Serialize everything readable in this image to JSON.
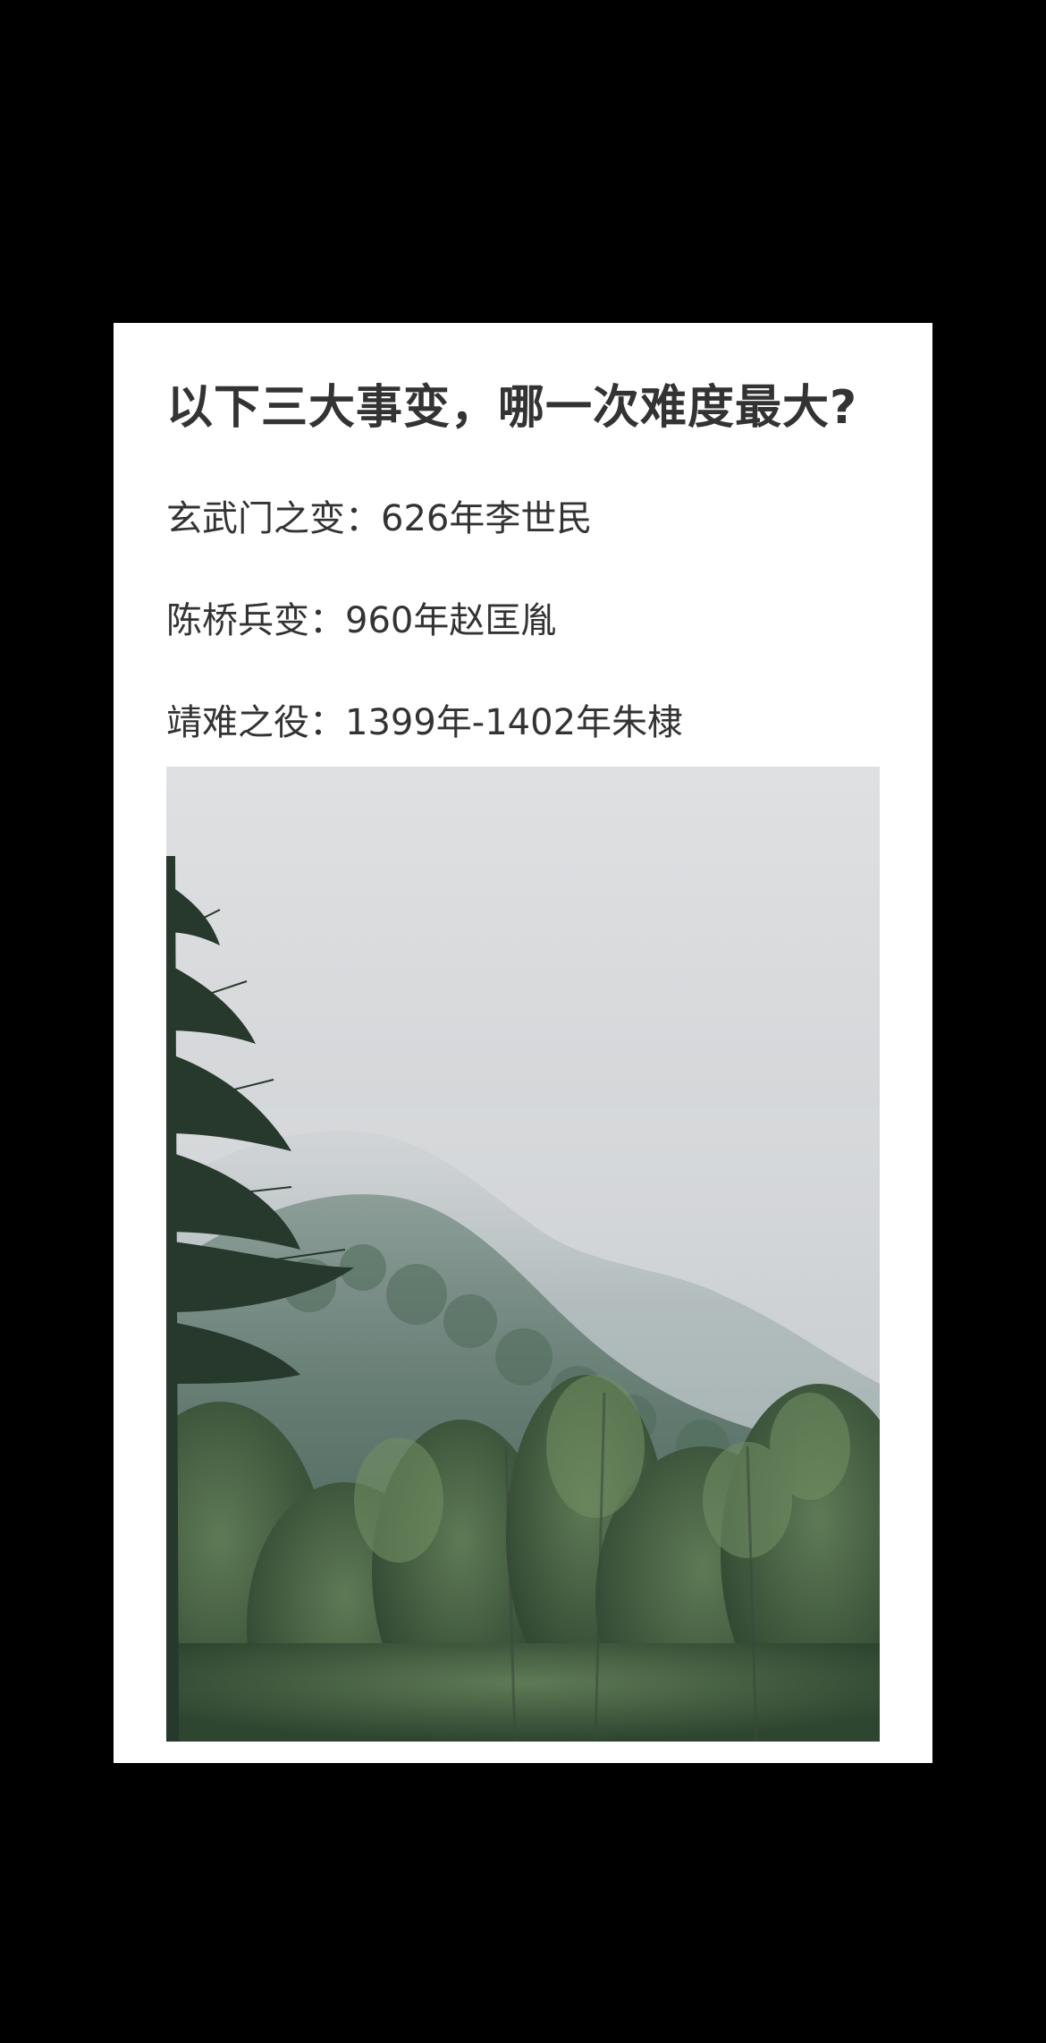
{
  "post": {
    "title": "以下三大事变，哪一次难度最大?",
    "lines": [
      "玄武门之变：626年李世民",
      "陈桥兵变：960年赵匡胤",
      "靖难之役：1399年-1402年朱棣"
    ]
  },
  "colors": {
    "background": "#000000",
    "card": "#ffffff",
    "text": "#333333"
  }
}
